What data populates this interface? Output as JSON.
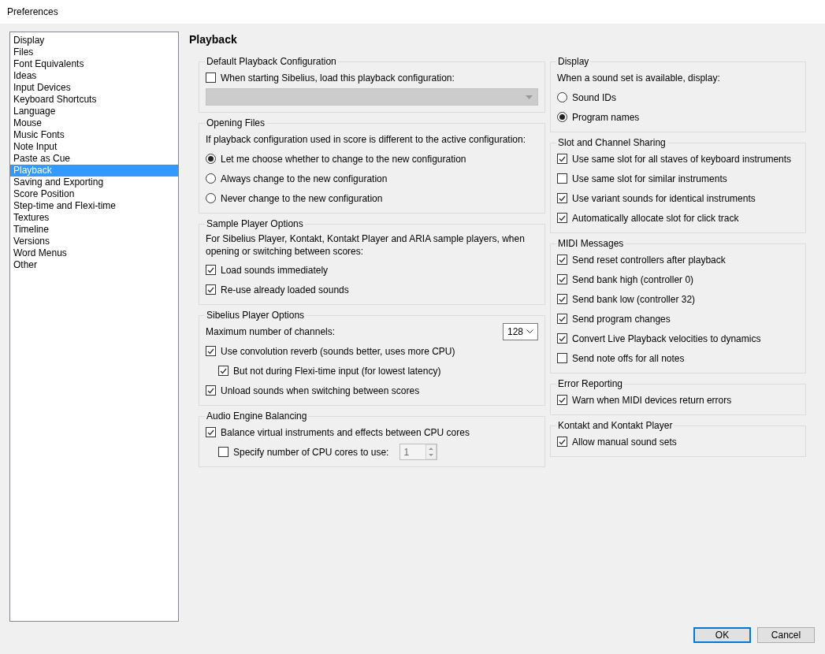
{
  "window": {
    "title": "Preferences"
  },
  "sidebar": {
    "items": [
      {
        "label": "Display",
        "selected": false
      },
      {
        "label": "Files",
        "selected": false
      },
      {
        "label": "Font Equivalents",
        "selected": false
      },
      {
        "label": "Ideas",
        "selected": false
      },
      {
        "label": "Input Devices",
        "selected": false
      },
      {
        "label": "Keyboard Shortcuts",
        "selected": false
      },
      {
        "label": "Language",
        "selected": false
      },
      {
        "label": "Mouse",
        "selected": false
      },
      {
        "label": "Music Fonts",
        "selected": false
      },
      {
        "label": "Note Input",
        "selected": false
      },
      {
        "label": "Paste as Cue",
        "selected": false
      },
      {
        "label": "Playback",
        "selected": true
      },
      {
        "label": "Saving and Exporting",
        "selected": false
      },
      {
        "label": "Score Position",
        "selected": false
      },
      {
        "label": "Step-time and Flexi-time",
        "selected": false
      },
      {
        "label": "Textures",
        "selected": false
      },
      {
        "label": "Timeline",
        "selected": false
      },
      {
        "label": "Versions",
        "selected": false
      },
      {
        "label": "Word Menus",
        "selected": false
      },
      {
        "label": "Other",
        "selected": false
      }
    ]
  },
  "page": {
    "title": "Playback",
    "columns": [
      {
        "groups": [
          {
            "title": "Default Playback Configuration",
            "items": [
              {
                "kind": "checkbox",
                "label": "When starting Sibelius, load this playback configuration:",
                "checked": false
              },
              {
                "kind": "dropdown",
                "disabled": true
              }
            ]
          },
          {
            "title": "Opening Files",
            "items": [
              {
                "kind": "text",
                "label": "If playback configuration used in score is different to the active configuration:"
              },
              {
                "kind": "radio",
                "label": "Let me choose whether to change to the new configuration",
                "selected": true
              },
              {
                "kind": "radio",
                "label": "Always change to the new configuration",
                "selected": false
              },
              {
                "kind": "radio",
                "label": "Never change to the new configuration",
                "selected": false
              }
            ]
          },
          {
            "title": "Sample Player Options",
            "items": [
              {
                "kind": "text",
                "label": "For Sibelius Player, Kontakt, Kontakt Player and ARIA sample players, when opening or switching between scores:"
              },
              {
                "kind": "checkbox",
                "label": "Load sounds immediately",
                "checked": true
              },
              {
                "kind": "checkbox",
                "label": "Re-use already loaded sounds",
                "checked": true
              }
            ]
          },
          {
            "title": "Sibelius Player Options",
            "items": [
              {
                "kind": "select",
                "label": "Maximum number of channels:",
                "value": "128"
              },
              {
                "kind": "checkbox",
                "label": "Use convolution reverb (sounds better, uses more CPU)",
                "checked": true,
                "children": [
                  {
                    "kind": "checkbox",
                    "label": "But not during Flexi-time input (for lowest latency)",
                    "checked": true
                  }
                ]
              },
              {
                "kind": "checkbox",
                "label": "Unload sounds when switching between scores",
                "checked": true
              }
            ]
          },
          {
            "title": "Audio Engine Balancing",
            "items": [
              {
                "kind": "checkbox",
                "label": "Balance virtual instruments and effects between CPU cores",
                "checked": true,
                "children": [
                  {
                    "kind": "spinner",
                    "label": "Specify number of CPU cores to use:",
                    "checked": false,
                    "value": "1",
                    "disabled": true
                  }
                ]
              }
            ]
          }
        ]
      },
      {
        "groups": [
          {
            "title": "Display",
            "items": [
              {
                "kind": "text",
                "label": "When a sound set is available, display:"
              },
              {
                "kind": "radio",
                "label": "Sound IDs",
                "selected": false
              },
              {
                "kind": "radio",
                "label": "Program names",
                "selected": true
              }
            ]
          },
          {
            "title": "Slot and Channel Sharing",
            "items": [
              {
                "kind": "checkbox",
                "label": "Use same slot for all staves of keyboard instruments",
                "checked": true
              },
              {
                "kind": "checkbox",
                "label": "Use same slot for similar instruments",
                "checked": false
              },
              {
                "kind": "checkbox",
                "label": "Use variant sounds for identical instruments",
                "checked": true
              },
              {
                "kind": "checkbox",
                "label": "Automatically allocate slot for click track",
                "checked": true
              }
            ]
          },
          {
            "title": "MIDI Messages",
            "items": [
              {
                "kind": "checkbox",
                "label": "Send reset controllers after playback",
                "checked": true
              },
              {
                "kind": "checkbox",
                "label": "Send bank high (controller 0)",
                "checked": true
              },
              {
                "kind": "checkbox",
                "label": "Send bank low (controller 32)",
                "checked": true
              },
              {
                "kind": "checkbox",
                "label": "Send program changes",
                "checked": true
              },
              {
                "kind": "checkbox",
                "label": "Convert Live Playback velocities to dynamics",
                "checked": true
              },
              {
                "kind": "checkbox",
                "label": "Send note offs for all notes",
                "checked": false
              }
            ]
          },
          {
            "title": "Error Reporting",
            "items": [
              {
                "kind": "checkbox",
                "label": "Warn when MIDI devices return errors",
                "checked": true
              }
            ]
          },
          {
            "title": "Kontakt and Kontakt Player",
            "items": [
              {
                "kind": "checkbox",
                "label": "Allow manual sound sets",
                "checked": true
              }
            ]
          }
        ]
      }
    ]
  },
  "buttons": [
    {
      "label": "OK",
      "default": true
    },
    {
      "label": "Cancel",
      "default": false
    }
  ]
}
